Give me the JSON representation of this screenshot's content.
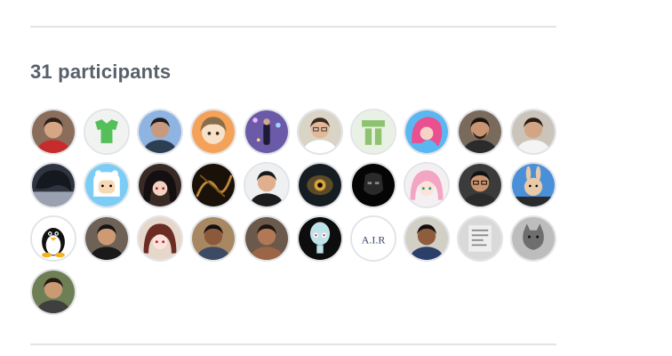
{
  "participants": {
    "title": "31 participants",
    "avatars": [
      {
        "name": "avatar-1",
        "icon": "person-red-shirt-icon"
      },
      {
        "name": "avatar-2",
        "icon": "green-shirt-logo-icon"
      },
      {
        "name": "avatar-3",
        "icon": "person-blue-background-icon"
      },
      {
        "name": "avatar-4",
        "icon": "anime-boy-icon"
      },
      {
        "name": "avatar-5",
        "icon": "person-purple-lights-icon"
      },
      {
        "name": "avatar-6",
        "icon": "person-glasses-icon"
      },
      {
        "name": "avatar-7",
        "icon": "green-t-logo-icon"
      },
      {
        "name": "avatar-8",
        "icon": "pink-hair-anime-icon"
      },
      {
        "name": "avatar-9",
        "icon": "person-beard-icon"
      },
      {
        "name": "avatar-10",
        "icon": "person-white-shirt-icon"
      },
      {
        "name": "avatar-11",
        "icon": "dark-anime-icon"
      },
      {
        "name": "avatar-12",
        "icon": "cartoon-finn-icon"
      },
      {
        "name": "avatar-13",
        "icon": "anime-girl-dark-hair-icon"
      },
      {
        "name": "avatar-14",
        "icon": "dark-abstract-icon"
      },
      {
        "name": "avatar-15",
        "icon": "person-black-shirt-icon"
      },
      {
        "name": "avatar-16",
        "icon": "dark-eye-icon"
      },
      {
        "name": "avatar-17",
        "icon": "dark-mask-icon"
      },
      {
        "name": "avatar-18",
        "icon": "anime-pink-hair-icon"
      },
      {
        "name": "avatar-19",
        "icon": "person-glasses-dark-icon"
      },
      {
        "name": "avatar-20",
        "icon": "cartoon-rabbit-icon"
      },
      {
        "name": "avatar-21",
        "icon": "linux-penguin-icon"
      },
      {
        "name": "avatar-22",
        "icon": "person-dark-jacket-icon"
      },
      {
        "name": "avatar-23",
        "icon": "anime-girl-brown-hair-icon"
      },
      {
        "name": "avatar-24",
        "icon": "person-smiling-icon"
      },
      {
        "name": "avatar-25",
        "icon": "person-shirtless-icon"
      },
      {
        "name": "avatar-26",
        "icon": "cartoon-squidward-icon"
      },
      {
        "name": "avatar-27",
        "icon": "air-logo-icon"
      },
      {
        "name": "avatar-28",
        "icon": "person-office-icon"
      },
      {
        "name": "avatar-29",
        "icon": "gray-sketch-icon"
      },
      {
        "name": "avatar-30",
        "icon": "gray-cat-icon"
      },
      {
        "name": "avatar-31",
        "icon": "person-outdoor-icon"
      }
    ],
    "air_logo_text": "A.I.R"
  }
}
